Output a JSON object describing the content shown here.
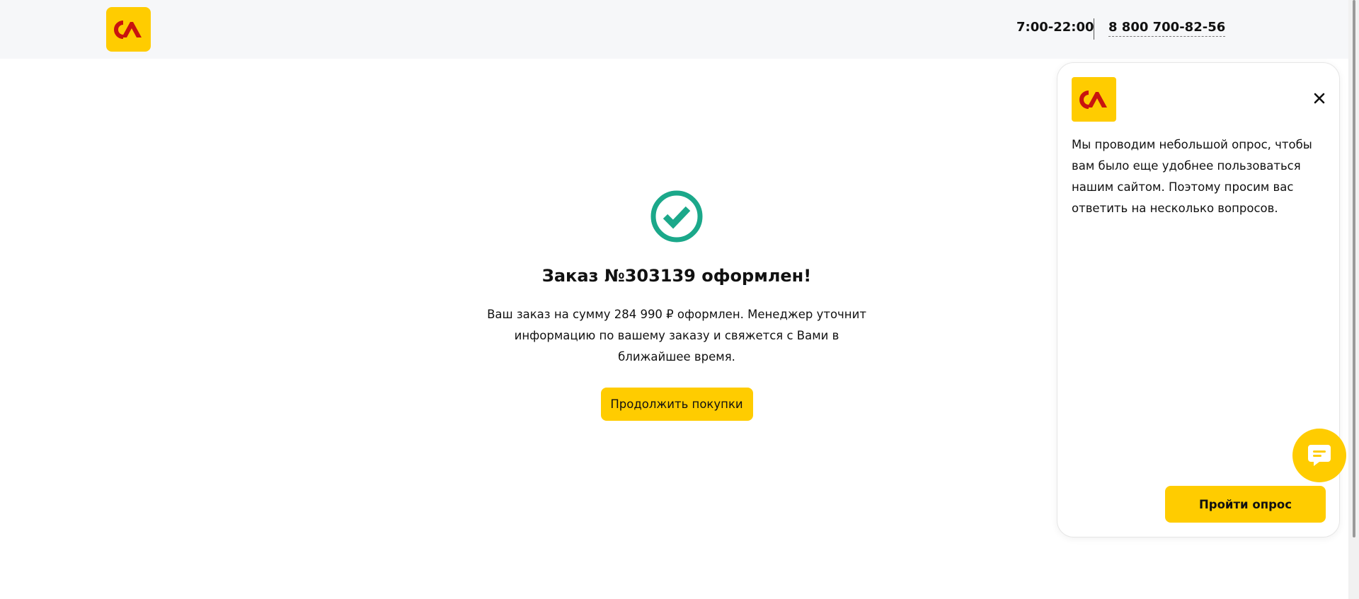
{
  "header": {
    "logo_icon": "sa-logo-icon",
    "hours": "7:00-22:00",
    "phone": "8 800 700-82-56"
  },
  "confirmation": {
    "icon": "check-circle-icon",
    "title": "Заказ №303139 оформлен!",
    "message": "Ваш заказ на сумму 284 990 ₽ оформлен. Менеджер уточнит информацию по вашему заказу и свяжется с Вами в ближайшее время.",
    "continue_label": "Продолжить покупки"
  },
  "survey": {
    "logo_icon": "sa-logo-icon",
    "close_icon": "close-icon",
    "text": "Мы проводим небольшой опрос, чтобы вам было еще удобнее пользоваться нашим сайтом. Поэтому просим вас ответить на несколько вопросов.",
    "button_label": "Пройти опрос"
  },
  "chat": {
    "icon": "chat-icon"
  },
  "colors": {
    "brand_yellow": "#ffcc00",
    "logo_red": "#c8140f",
    "success_green": "#1ba88a",
    "header_bg": "#f6f7f9"
  }
}
